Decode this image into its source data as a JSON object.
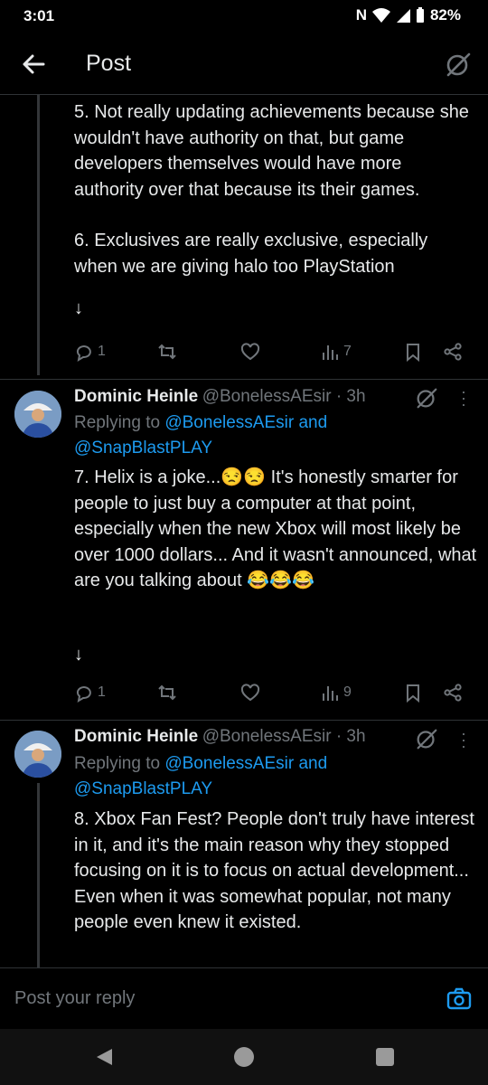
{
  "status": {
    "time": "3:01",
    "battery": "82%"
  },
  "header": {
    "title": "Post"
  },
  "post1": {
    "text_a": "5. Not really updating achievements because she wouldn't have authority on that, but game developers themselves would have more authority over that because its their games.",
    "text_b": "6. Exclusives are really exclusive, especially when we are giving halo too PlayStation",
    "show_more": "↓",
    "replies": "1",
    "views": "7"
  },
  "post2": {
    "name": "Dominic Heinle",
    "handle": "@BonelessAEsir · 3h",
    "replying_prefix": "Replying to ",
    "replying_user1": "@BonelessAEsir",
    "replying_and": " and",
    "replying_user2": "@SnapBlastPLAY",
    "text": "7. Helix is a joke...😒😒 It's honestly smarter for people to just buy a computer at that point, especially when the new Xbox will most likely be over 1000 dollars... And it wasn't announced, what are you talking about 😂😂😂",
    "show_more": "↓",
    "replies": "1",
    "views": "9"
  },
  "post3": {
    "name": "Dominic Heinle",
    "handle": "@BonelessAEsir · 3h",
    "replying_prefix": "Replying to ",
    "replying_user1": "@BonelessAEsir",
    "replying_and": " and",
    "replying_user2": "@SnapBlastPLAY",
    "text": "8. Xbox Fan Fest? People don't truly have interest in it, and it's the main reason why they stopped focusing on it is to focus on actual development... Even when it was somewhat popular, not many people even knew it existed."
  },
  "reply": {
    "placeholder": "Post your reply"
  },
  "colors": {
    "accent": "#1d9bf0",
    "muted": "#71767b",
    "text": "#e7e9ea",
    "background": "#000000"
  }
}
